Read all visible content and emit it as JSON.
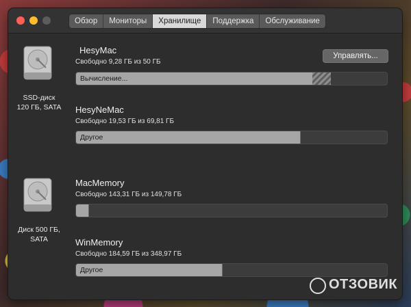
{
  "window": {
    "tabs": [
      {
        "label": "Обзор",
        "active": false
      },
      {
        "label": "Мониторы",
        "active": false
      },
      {
        "label": "Хранилище",
        "active": true
      },
      {
        "label": "Поддержка",
        "active": false
      },
      {
        "label": "Обслуживание",
        "active": false
      }
    ]
  },
  "disks": [
    {
      "caption_line1": "SSD-диск",
      "caption_line2": "120 ГБ, SATA"
    },
    {
      "caption_line1": "Диск 500 ГБ,",
      "caption_line2": "SATA"
    }
  ],
  "volumes": [
    {
      "name": "HesyMac",
      "free": "Свободно 9,28 ГБ из 50 ГБ",
      "bar_label": "Вычисление...",
      "used_fraction": 0.76,
      "calculating_fraction": 0.06
    },
    {
      "name": "HesyNeMac",
      "free": "Свободно 19,53 ГБ из 69,81 ГБ",
      "bar_label": "Другое",
      "used_fraction": 0.72
    },
    {
      "name": "MacMemory",
      "free": "Свободно 143,31 ГБ из 149,78 ГБ",
      "bar_label": "",
      "used_fraction": 0.04
    },
    {
      "name": "WinMemory",
      "free": "Свободно 184,59 ГБ из 348,97 ГБ",
      "bar_label": "Другое",
      "used_fraction": 0.47
    }
  ],
  "manage_button": "Управлять...",
  "watermark": "ОТЗОВИК",
  "colors": {
    "close": "#ff5f57",
    "minimize": "#febc2e",
    "bar_fill": "#a6a6a6",
    "window_bg": "#2d2d2d"
  }
}
